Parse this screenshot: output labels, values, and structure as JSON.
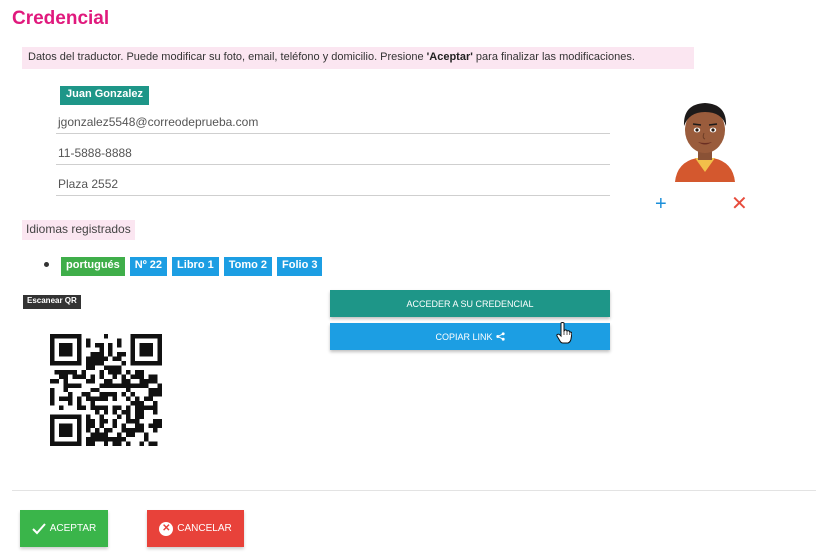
{
  "page": {
    "title": "Credencial",
    "info_text_pre": "Datos del traductor. Puede modificar su foto, email, teléfono y domicilio. Presione ",
    "info_text_bold": "'Aceptar'",
    "info_text_post": " para finalizar las modificaciones."
  },
  "translator": {
    "name": "Juan Gonzalez",
    "email": "jgonzalez5548@correodeprueba.com",
    "phone": "11-5888-8888",
    "address": "Plaza 2552"
  },
  "photo": {
    "add_symbol": "+",
    "remove_symbol": "✕"
  },
  "languages": {
    "header": "Idiomas registrados",
    "items": [
      {
        "language": "portugués",
        "numero": "Nº 22",
        "libro": "Libro 1",
        "tomo": "Tomo 2",
        "folio": "Folio 3"
      }
    ]
  },
  "qr": {
    "label": "Escanear QR"
  },
  "actions": {
    "access_label": "ACCEDER A SU CREDENCIAL",
    "copy_label": "COPIAR LINK",
    "accept_label": "ACEPTAR",
    "cancel_label": "CANCELAR"
  },
  "icons": {
    "check": "check-icon",
    "share": "share-icon",
    "cancel": "x-circle-icon",
    "add": "plus-icon",
    "remove": "close-icon"
  },
  "colors": {
    "title": "#e0197d",
    "highlight_bg": "#fbe6f1",
    "teal": "#1e9688",
    "blue": "#1c9ee3",
    "green": "#3fae4a",
    "red": "#e8423a"
  }
}
